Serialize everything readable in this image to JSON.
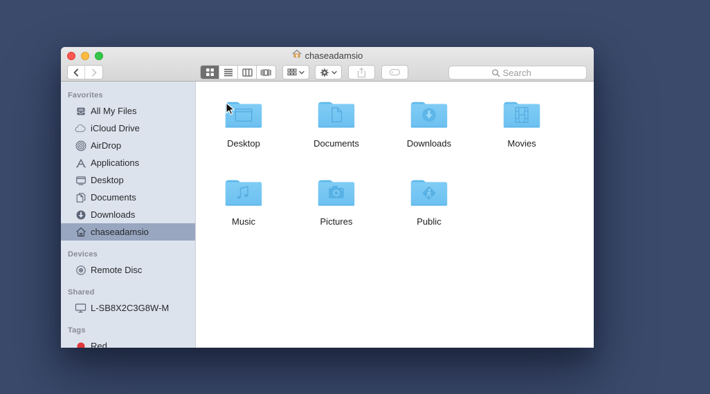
{
  "window": {
    "title": "chaseadamsio",
    "search_placeholder": "Search",
    "colors": {
      "desktop_bg": "#3b4a6b",
      "sidebar_bg": "#dde3ed",
      "selection": "#98a6c0",
      "folder_blue": "#76c7f3",
      "folder_emblem": "#55acdf",
      "tag_red": "#e0383e"
    },
    "toolbar": {
      "view_modes": [
        "icon",
        "list",
        "column",
        "coverflow"
      ],
      "selected_view": "icon"
    },
    "sidebar": {
      "sections": [
        {
          "title": "Favorites",
          "items": [
            {
              "label": "All My Files",
              "icon": "all-my-files"
            },
            {
              "label": "iCloud Drive",
              "icon": "icloud"
            },
            {
              "label": "AirDrop",
              "icon": "airdrop"
            },
            {
              "label": "Applications",
              "icon": "applications"
            },
            {
              "label": "Desktop",
              "icon": "desktop"
            },
            {
              "label": "Documents",
              "icon": "documents"
            },
            {
              "label": "Downloads",
              "icon": "downloads"
            },
            {
              "label": "chaseadamsio",
              "icon": "home",
              "selected": true
            }
          ]
        },
        {
          "title": "Devices",
          "items": [
            {
              "label": "Remote Disc",
              "icon": "optical-disc"
            }
          ]
        },
        {
          "title": "Shared",
          "items": [
            {
              "label": "L-SB8X2C3G8W-M",
              "icon": "computer"
            }
          ]
        },
        {
          "title": "Tags",
          "items": [
            {
              "label": "Red",
              "icon": "red-tag"
            }
          ]
        }
      ]
    },
    "folders": [
      {
        "label": "Desktop",
        "emblem": "desktop"
      },
      {
        "label": "Documents",
        "emblem": "document"
      },
      {
        "label": "Downloads",
        "emblem": "download-arrow"
      },
      {
        "label": "Movies",
        "emblem": "filmstrip"
      },
      {
        "label": "Music",
        "emblem": "music-note"
      },
      {
        "label": "Pictures",
        "emblem": "camera"
      },
      {
        "label": "Public",
        "emblem": "public-sign"
      }
    ]
  }
}
